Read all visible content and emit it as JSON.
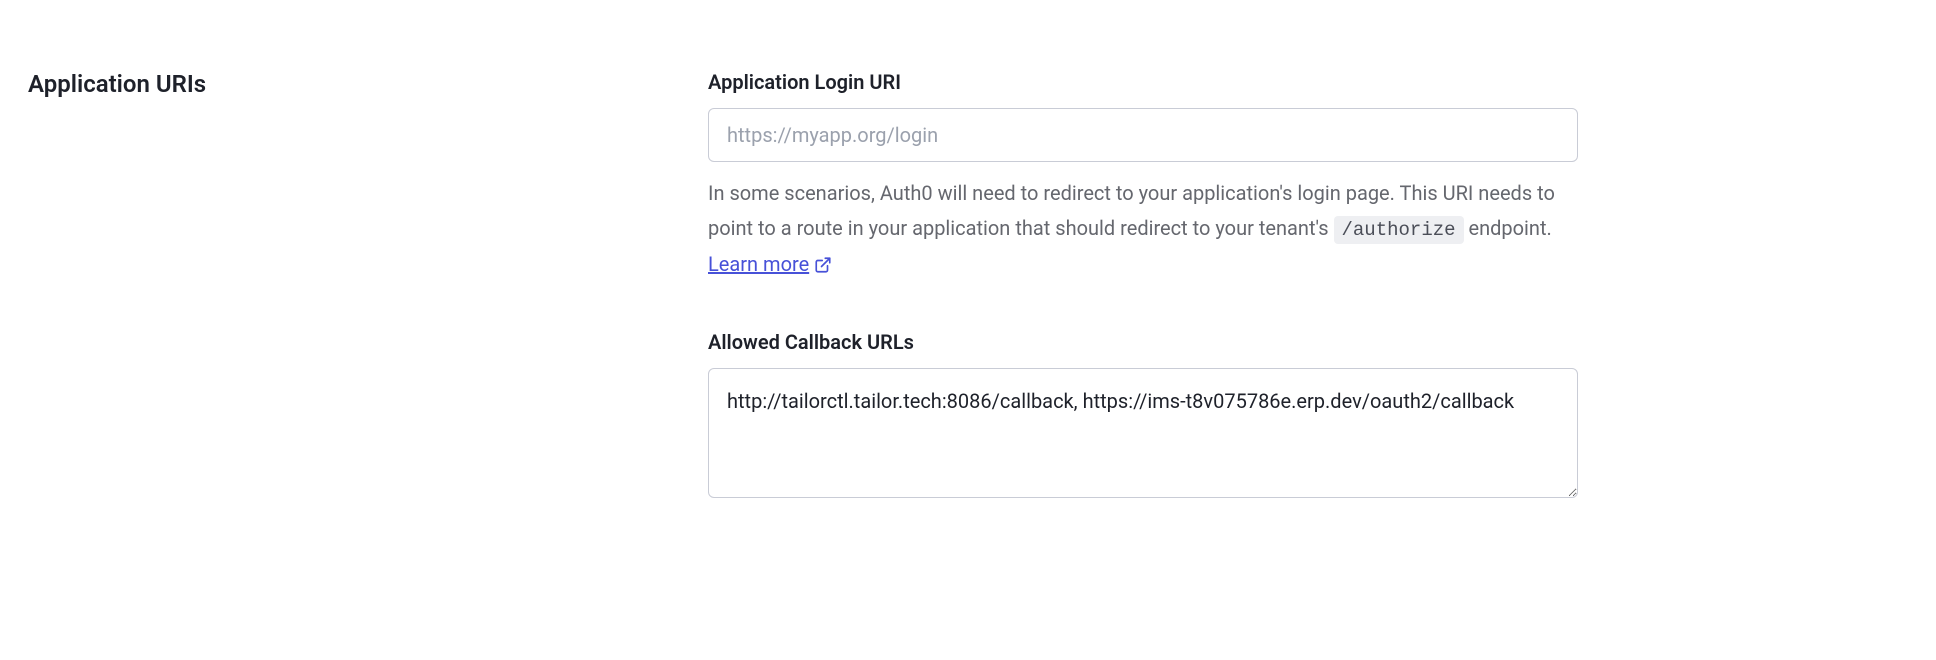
{
  "section": {
    "title": "Application URIs"
  },
  "login_uri": {
    "label": "Application Login URI",
    "placeholder": "https://myapp.org/login",
    "value": "",
    "help_prefix": "In some scenarios, Auth0 will need to redirect to your application's login page. This URI needs to point to a route in your application that should redirect to your tenant's ",
    "help_code": "/authorize",
    "help_suffix": " endpoint. ",
    "learn_more": "Learn more"
  },
  "callback_urls": {
    "label": "Allowed Callback URLs",
    "value": "http://tailorctl.tailor.tech:8086/callback, https://ims-t8v075786e.erp.dev/oauth2/callback"
  }
}
